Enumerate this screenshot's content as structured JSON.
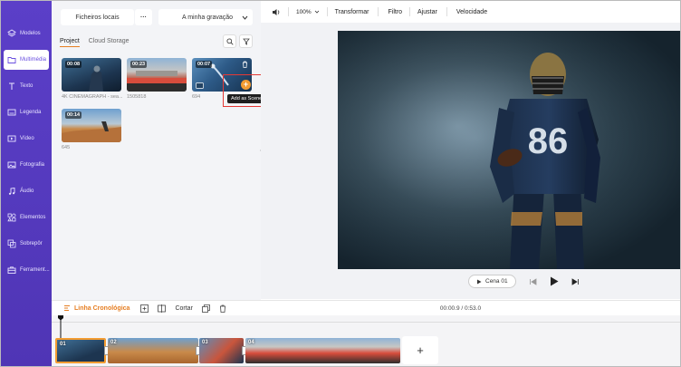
{
  "sidebar": {
    "items": [
      {
        "label": "Modelos",
        "icon": "layers-icon"
      },
      {
        "label": "Multimédia",
        "icon": "folder-icon"
      },
      {
        "label": "Texto",
        "icon": "text-icon"
      },
      {
        "label": "Legenda",
        "icon": "caption-icon"
      },
      {
        "label": "Vídeo",
        "icon": "video-icon"
      },
      {
        "label": "Fotografia",
        "icon": "image-icon"
      },
      {
        "label": "Áudio",
        "icon": "music-icon"
      },
      {
        "label": "Elementos",
        "icon": "elements-icon"
      },
      {
        "label": "Sobrepôr",
        "icon": "overlay-icon"
      },
      {
        "label": "Ferrament...",
        "icon": "toolbox-icon"
      }
    ]
  },
  "media": {
    "local_files_label": "Ficheiros locais",
    "more_label": "···",
    "recording_label": "A minha gravação",
    "tabs": [
      "Project",
      "Cloud Storage"
    ],
    "thumbs": [
      {
        "duration": "00:08",
        "name": "4K CINEMAGRAPH - sea..."
      },
      {
        "duration": "00:23",
        "name": "1505818"
      },
      {
        "duration": "00:07",
        "name": "694"
      },
      {
        "duration": "00:14",
        "name": "645"
      }
    ],
    "add_tooltip": "Add as Scene"
  },
  "topbar": {
    "zoom": "100%",
    "items": [
      "Transformar",
      "Filtro",
      "Ajustar",
      "Velocidade"
    ]
  },
  "player": {
    "scene_label": "Cena 01"
  },
  "timeline": {
    "tab_label": "Linha Cronológica",
    "cut_label": "Cortar",
    "time": "00:00.9 / 0:53.0",
    "clips": [
      "01",
      "02",
      "03",
      "04"
    ]
  },
  "colors": {
    "sidebar": "#5b3fc8",
    "accent": "#f39c32",
    "highlight": "#e53935"
  }
}
